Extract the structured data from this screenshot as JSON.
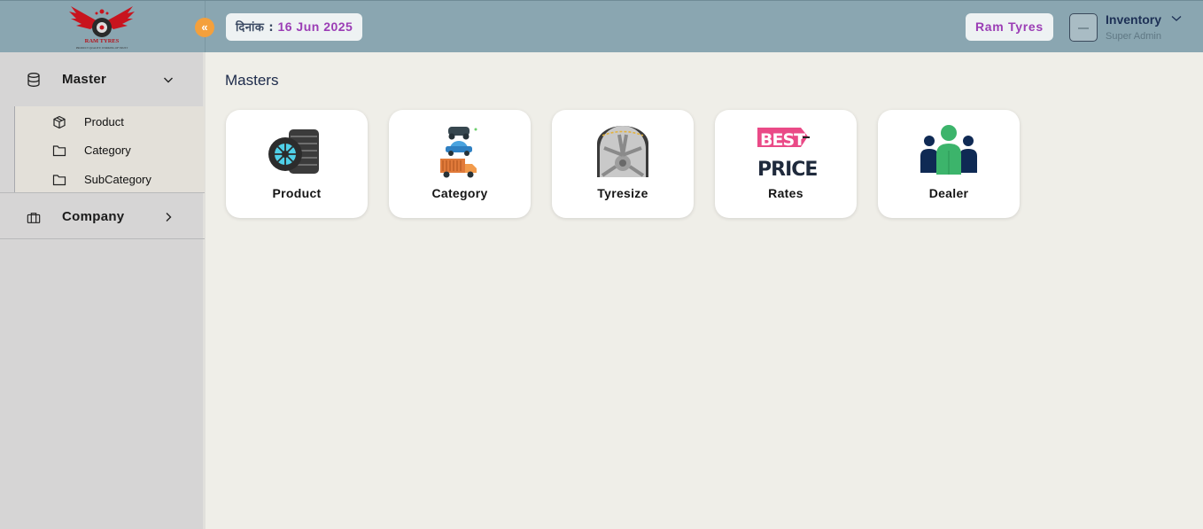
{
  "brand": {
    "logo_text": "RAM TYRES",
    "logo_tagline": "PRODUCT QUALITY, WORKING OF TRUST"
  },
  "header": {
    "date_label": "दिनांक :",
    "date_value": "16 Jun 2025",
    "firm_name": "Ram Tyres",
    "user_name": "Inventory",
    "user_role": "Super Admin",
    "collapse_glyph": "«",
    "chevron_glyph": "⌄"
  },
  "sidebar": {
    "master": {
      "label": "Master",
      "icon": "database-icon",
      "expanded": true
    },
    "sub_items": [
      {
        "label": "Product",
        "icon": "cube-icon"
      },
      {
        "label": "Category",
        "icon": "folder-icon"
      },
      {
        "label": "SubCategory",
        "icon": "folder-icon"
      }
    ],
    "company": {
      "label": "Company",
      "icon": "briefcase-icon",
      "expanded": false
    }
  },
  "main": {
    "title": "Masters",
    "cards": [
      {
        "label": "Product",
        "icon": "tyre-stack-icon"
      },
      {
        "label": "Category",
        "icon": "vehicles-icon"
      },
      {
        "label": "Tyresize",
        "icon": "tyre-wheel-icon"
      },
      {
        "label": "Rates",
        "icon": "best-price-icon"
      },
      {
        "label": "Dealer",
        "icon": "people-group-icon"
      }
    ]
  },
  "colors": {
    "accent": "#9b3db5",
    "topbar": "#8aa6b1",
    "collapse": "#f4a03c",
    "sidebar": "#d6d5d5",
    "page": "#efeee8"
  }
}
